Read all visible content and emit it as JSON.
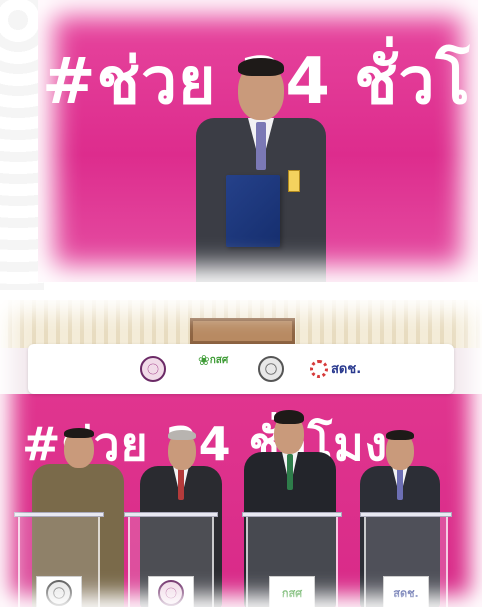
{
  "photos": {
    "top": {
      "background_slogan": "#ช่วย 24 ชั่วโ"
    },
    "bottom": {
      "background_slogan": "#ช่วย 24 ชั่วโมง",
      "logos": [
        "emblem-logo",
        "kasat-logo",
        "gear-emblem-logo",
        "sdch-logo"
      ],
      "kasat_label": "กสศ",
      "sdch_label": "สดช.",
      "podium_signs": [
        {
          "icon": "emblem-logo"
        },
        {
          "icon": "emblem-logo"
        },
        {
          "icon": "kasat-logo",
          "label": "กสศ"
        },
        {
          "icon": "sdch-logo",
          "label": "สดช."
        }
      ]
    }
  },
  "colors": {
    "backdrop_magenta": "#dd2c8d",
    "suit_dark": "#2b2d33",
    "folder_blue": "#1c3578"
  }
}
